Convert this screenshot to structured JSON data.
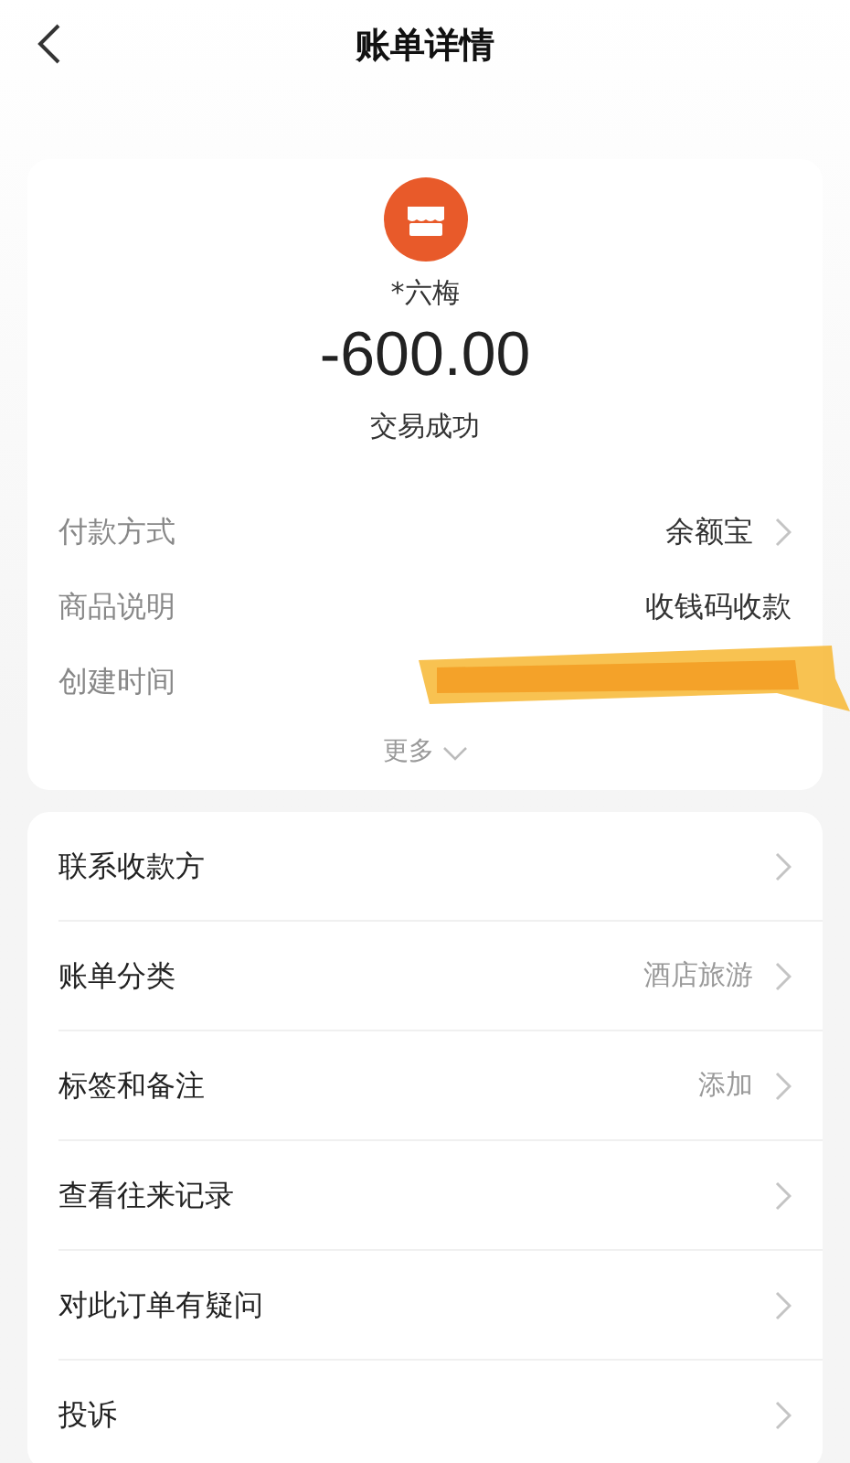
{
  "header": {
    "title": "账单详情"
  },
  "summary": {
    "payee": "*六梅",
    "amount": "-600.00",
    "status": "交易成功"
  },
  "details": [
    {
      "label": "付款方式",
      "value": "余额宝",
      "kind": "link"
    },
    {
      "label": "商品说明",
      "value": "收钱码收款",
      "kind": "plain"
    },
    {
      "label": "创建时间",
      "kind": "redacted"
    }
  ],
  "more": "更多",
  "actions": [
    {
      "label": "联系收款方"
    },
    {
      "label": "账单分类",
      "value": "酒店旅游"
    },
    {
      "label": "标签和备注",
      "value": "添加"
    },
    {
      "label": "查看往来记录"
    },
    {
      "label": "对此订单有疑问"
    },
    {
      "label": "投诉"
    }
  ]
}
